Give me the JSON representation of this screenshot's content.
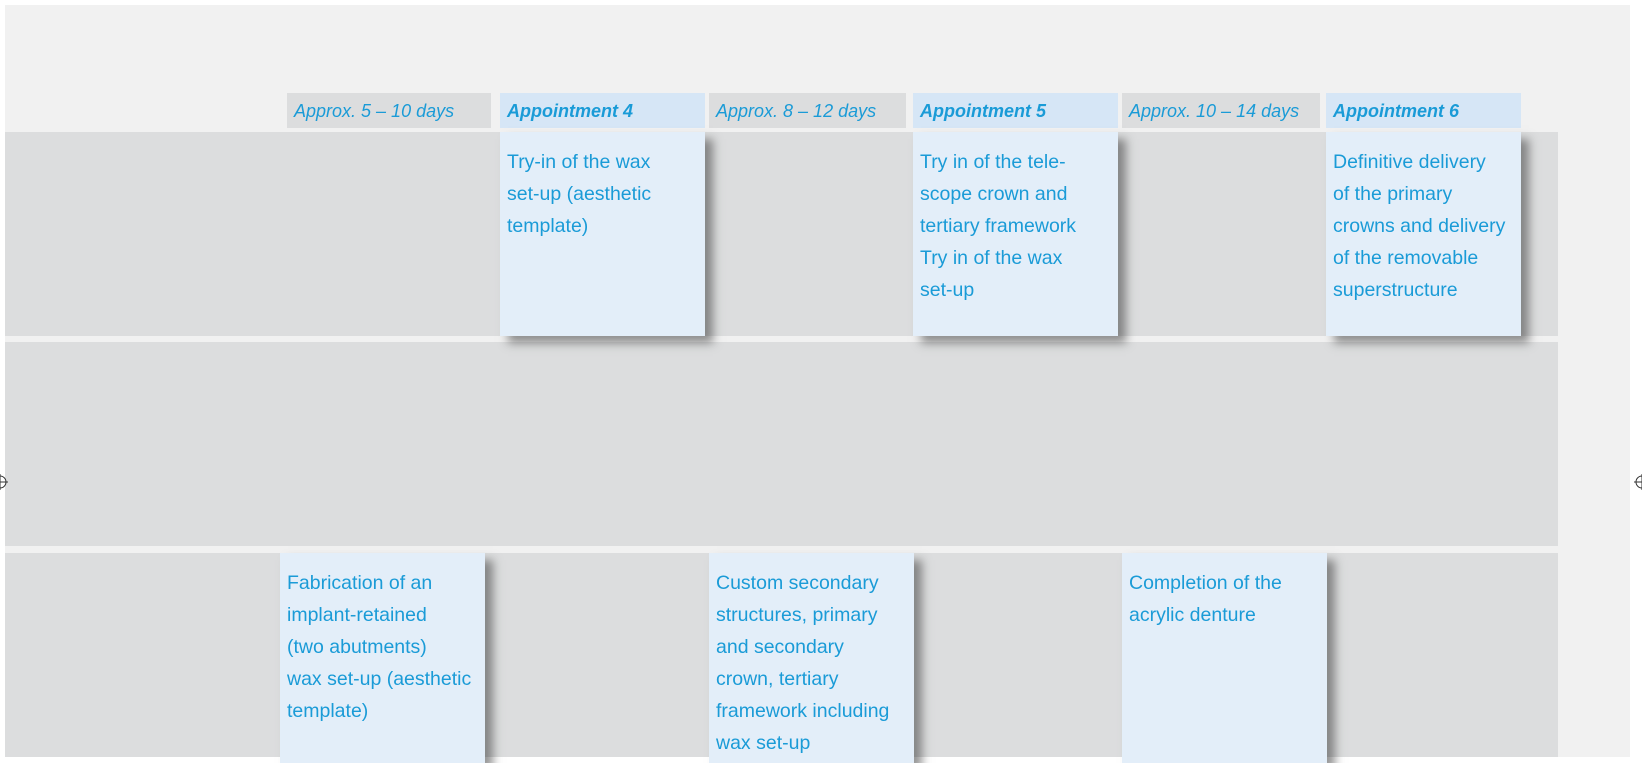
{
  "timeline_headers": [
    {
      "label": "Approx. 5 – 10 days",
      "kind": "interval"
    },
    {
      "label": "Appointment 4",
      "kind": "appointment"
    },
    {
      "label": "Approx. 8 – 12 days",
      "kind": "interval"
    },
    {
      "label": "Appointment 5",
      "kind": "appointment"
    },
    {
      "label": "Approx. 10 – 14 days",
      "kind": "interval"
    },
    {
      "label": "Appointment 6",
      "kind": "appointment"
    }
  ],
  "clinic_steps": [
    {
      "appointment": "Appointment 4",
      "lines": [
        "Try-in of the wax",
        "set-up (aesthetic",
        "template)"
      ]
    },
    {
      "appointment": "Appointment 5",
      "lines": [
        "Try in of the tele-",
        "scope crown and",
        "tertiary framework",
        "Try in of the wax",
        "set-up"
      ]
    },
    {
      "appointment": "Appointment 6",
      "lines": [
        "Definitive delivery",
        "of the primary",
        "crowns and delivery",
        "of the removable",
        "superstructure"
      ]
    }
  ],
  "lab_steps": [
    {
      "interval": "Approx. 5 – 10 days",
      "lines": [
        "Fabrication of an",
        "implant-retained",
        "(two abutments)",
        "wax set-up (aesthetic",
        "template)"
      ]
    },
    {
      "interval": "Approx. 8 – 12 days",
      "lines": [
        "Custom secondary",
        "structures, primary",
        "and secondary",
        "crown, tertiary",
        "framework including",
        "wax set-up"
      ]
    },
    {
      "interval": "Approx. 10 – 14 days",
      "lines": [
        "Completion of the",
        "acrylic denture"
      ]
    }
  ],
  "colors": {
    "page_background": "#f1f1f1",
    "band": "#dcddde",
    "appointment_header": "#d6e6f6",
    "card": "#e3eef9",
    "text_accent": "#1a9bd7"
  }
}
